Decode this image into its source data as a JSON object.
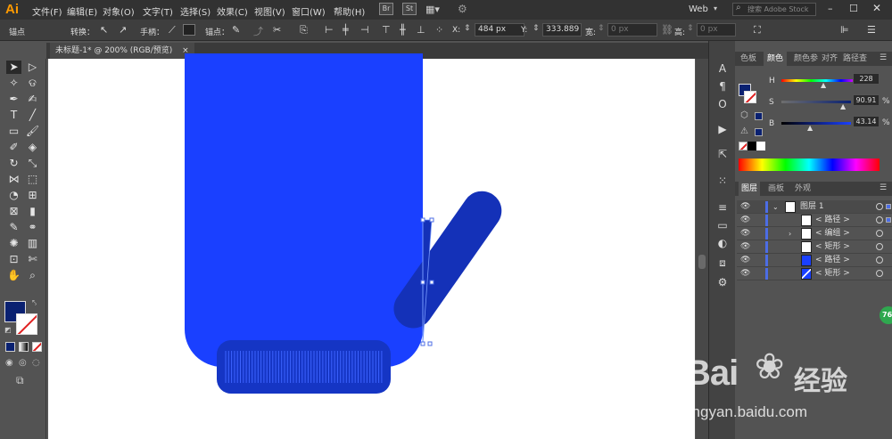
{
  "menubar": {
    "logo": "Ai",
    "items": [
      "文件(F)",
      "编辑(E)",
      "对象(O)",
      "文字(T)",
      "选择(S)",
      "效果(C)",
      "视图(V)",
      "窗口(W)",
      "帮助(H)"
    ],
    "br": "Br",
    "st": "St",
    "workspace": "Web",
    "search_placeholder": "搜索 Adobe Stock"
  },
  "controlbar": {
    "mode": "锚点",
    "convert": "转换：",
    "handle": "手柄：",
    "anchor": "锚点：",
    "x_label": "X:",
    "x_value": "484 px",
    "y_label": "Y:",
    "y_value": "333.889",
    "w_label": "宽:",
    "w_value": "0 px",
    "h_label": "高:",
    "h_value": "0 px"
  },
  "document": {
    "tab_title": "未标题-1* @ 200% (RGB/预览)",
    "close": "×"
  },
  "panel": {
    "tabs": [
      "色板",
      "颜色",
      "颜色参",
      "对齐",
      "路径查"
    ],
    "active_tab": "颜色",
    "color": {
      "h_label": "H",
      "h_value": "228",
      "s_label": "S",
      "s_value": "90.91",
      "s_unit": "%",
      "b_label": "B",
      "b_value": "43.14",
      "b_unit": "%",
      "fill_hex": "#0a2171"
    },
    "layer_tabs": [
      "图层",
      "画板",
      "外观"
    ],
    "layers": [
      {
        "name": "图层 1",
        "indent": 0,
        "expanded": true
      },
      {
        "name": "< 路径 >",
        "indent": 1,
        "expanded": false
      },
      {
        "name": "< 编组 >",
        "indent": 1,
        "expanded": false,
        "has_children": true
      },
      {
        "name": "< 矩形 >",
        "indent": 1,
        "expanded": false
      },
      {
        "name": "< 路径 >",
        "indent": 1,
        "expanded": false
      },
      {
        "name": "< 矩形 >",
        "indent": 1,
        "expanded": false
      }
    ]
  },
  "colors": {
    "mitten_body": "#1a40ff",
    "mitten_cuff": "#1535c4",
    "thumb": "#1431b8",
    "swatch_fill": "#0a2171",
    "accent": "#4c6de5"
  },
  "watermark": {
    "brand": "Bai",
    "brand_cn": "经验",
    "url": "jingyan.baidu.com"
  },
  "badge": "76"
}
